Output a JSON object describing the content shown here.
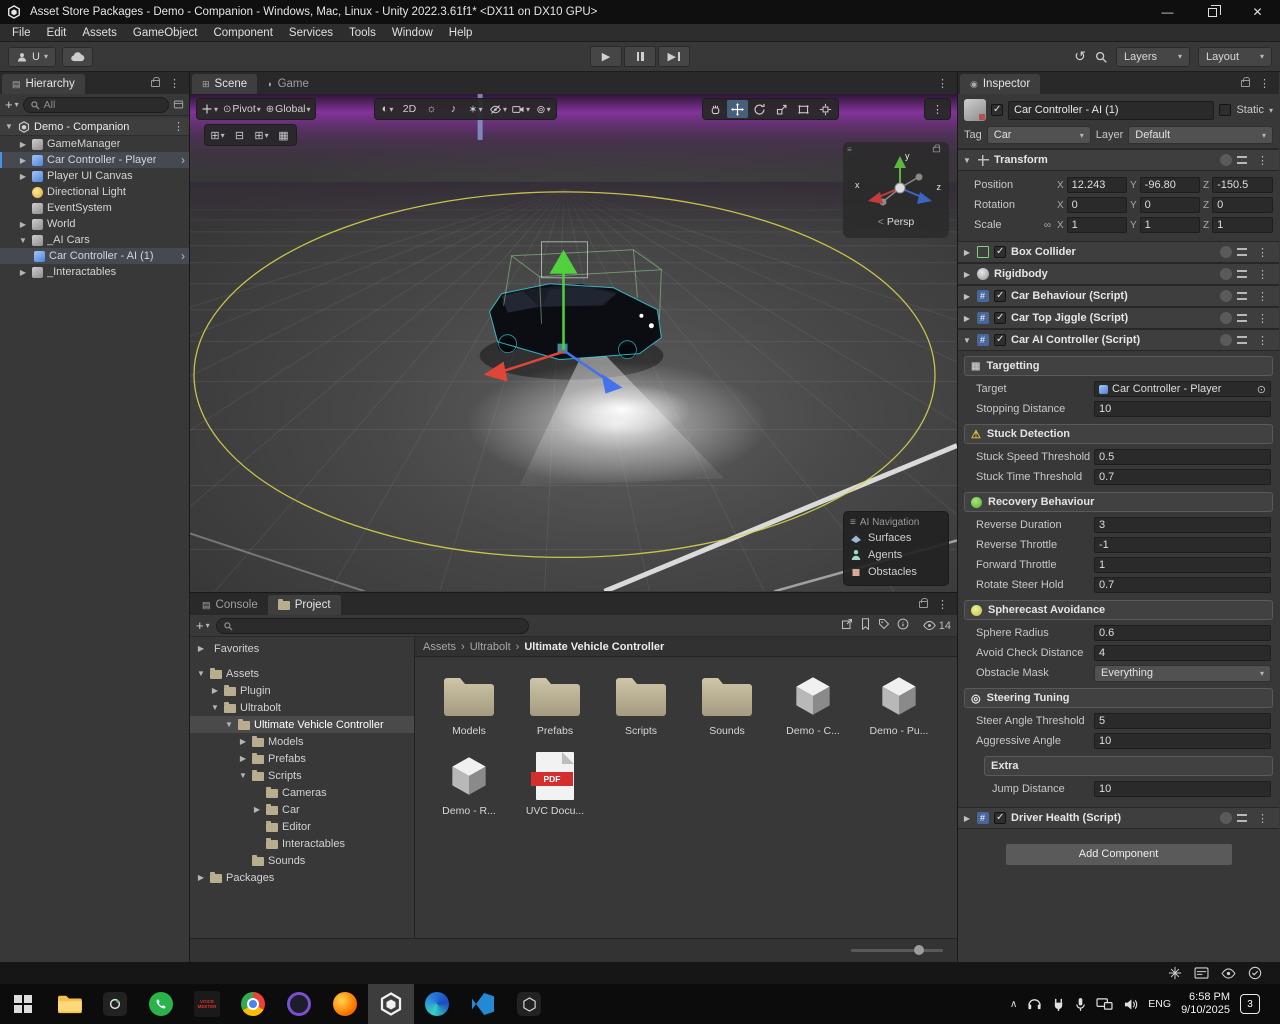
{
  "window": {
    "title": "Asset Store Packages - Demo - Companion - Windows, Mac, Linux - Unity 2022.3.61f1* <DX11 on DX10 GPU>"
  },
  "menu": {
    "items": [
      "File",
      "Edit",
      "Assets",
      "GameObject",
      "Component",
      "Services",
      "Tools",
      "Window",
      "Help"
    ]
  },
  "toolbar": {
    "account": "U",
    "layers": "Layers",
    "layout": "Layout"
  },
  "glyphs": {
    "caret": "▾",
    "open": "▼",
    "closed": "▶",
    "kebab": "⋮",
    "plus": "+",
    "chevron": "›",
    "close": "✕",
    "minimize": "—",
    "play": "▶",
    "undo": "↺",
    "link": "∞",
    "picker": "⊙",
    "list": "▤",
    "grid": "⊞",
    "grid_minus": "⊟",
    "grid_fill": "▦",
    "halfcircle": "◗",
    "insp": "◉",
    "shading": "◐",
    "light": "☼",
    "audio": "♪",
    "fx": "✶",
    "globe": "⊕",
    "gizmos": "⊚",
    "handle": "≡",
    "lt": "<",
    "sep": "›",
    "chevron_up": "∧",
    "hash": "#"
  },
  "hierarchy": {
    "tab": "Hierarchy",
    "filter": "All",
    "scene_name": "Demo - Companion",
    "items": [
      {
        "label": "GameManager",
        "arrow": "▶"
      },
      {
        "label": "Car Controller - Player",
        "arrow": "▶"
      },
      {
        "label": "Player UI Canvas",
        "arrow": "▶"
      },
      {
        "label": "Directional Light",
        "arrow": ""
      },
      {
        "label": "EventSystem",
        "arrow": ""
      },
      {
        "label": "World",
        "arrow": "▶"
      },
      {
        "label": "_AI Cars",
        "arrow": "▼"
      },
      {
        "label": "Car Controller - AI (1)",
        "arrow": ""
      },
      {
        "label": "_Interactables",
        "arrow": "▶"
      }
    ]
  },
  "scene": {
    "tabs": [
      "Scene",
      "Game"
    ],
    "pivot": "Pivot",
    "global": "Global",
    "two_d": "2D",
    "persp": "Persp",
    "axes": {
      "x": "x",
      "y": "y",
      "z": "z"
    },
    "ai_nav": {
      "title": "AI Navigation",
      "rows": [
        "Surfaces",
        "Agents",
        "Obstacles"
      ]
    }
  },
  "project": {
    "tabs": [
      "Console",
      "Project"
    ],
    "favorites": "Favorites",
    "hidden_count": "14",
    "pdf_label": "PDF",
    "tree": [
      {
        "label": "Assets",
        "arrow": "▼"
      },
      {
        "label": "Plugin",
        "arrow": "▶"
      },
      {
        "label": "Ultrabolt",
        "arrow": "▼"
      },
      {
        "label": "Ultimate Vehicle Controller",
        "arrow": "▼"
      },
      {
        "label": "Models",
        "arrow": "▶"
      },
      {
        "label": "Prefabs",
        "arrow": "▶"
      },
      {
        "label": "Scripts",
        "arrow": "▼"
      },
      {
        "label": "Cameras",
        "arrow": ""
      },
      {
        "label": "Car",
        "arrow": "▶"
      },
      {
        "label": "Editor",
        "arrow": ""
      },
      {
        "label": "Interactables",
        "arrow": ""
      },
      {
        "label": "Sounds",
        "arrow": ""
      },
      {
        "label": "Packages",
        "arrow": "▶"
      }
    ],
    "breadcrumb": [
      "Assets",
      "Ultrabolt",
      "Ultimate Vehicle Controller"
    ],
    "items": [
      {
        "label": "Models",
        "type": "folder"
      },
      {
        "label": "Prefabs",
        "type": "folder"
      },
      {
        "label": "Scripts",
        "type": "folder"
      },
      {
        "label": "Sounds",
        "type": "folder"
      },
      {
        "label": "Demo - C...",
        "type": "unity"
      },
      {
        "label": "Demo - Pu...",
        "type": "unity"
      },
      {
        "label": "Demo - R...",
        "type": "unity"
      },
      {
        "label": "UVC Docu...",
        "type": "pdf"
      }
    ]
  },
  "inspector": {
    "tab": "Inspector",
    "header": {
      "name": "Car Controller - AI (1)",
      "static": "Static",
      "tag_label": "Tag",
      "tag": "Car",
      "layer_label": "Layer",
      "layer": "Default"
    },
    "transform": {
      "title": "Transform",
      "axes": {
        "x": "X",
        "y": "Y",
        "z": "Z"
      },
      "rows": [
        {
          "label": "Position",
          "x": "12.243",
          "y": "-96.80",
          "z": "-150.5"
        },
        {
          "label": "Rotation",
          "x": "0",
          "y": "0",
          "z": "0"
        },
        {
          "label": "Scale",
          "x": "1",
          "y": "1",
          "z": "1"
        }
      ]
    },
    "components": [
      {
        "title": "Box Collider"
      },
      {
        "title": "Rigidbody"
      },
      {
        "title": "Car Behaviour (Script)"
      },
      {
        "title": "Car Top Jiggle (Script)"
      },
      {
        "title": "Car AI Controller (Script)"
      },
      {
        "title": "Driver Health (Script)"
      }
    ],
    "car_ai": {
      "sections": [
        {
          "title": "Targetting"
        },
        {
          "title": "Stuck Detection"
        },
        {
          "title": "Recovery Behaviour"
        },
        {
          "title": "Spherecast Avoidance"
        },
        {
          "title": "Steering Tuning"
        },
        {
          "title": "Extra"
        }
      ],
      "target_label": "Target",
      "target_value": "Car Controller - Player",
      "props": [
        {
          "label": "Stopping Distance",
          "value": "10"
        },
        {
          "label": "Stuck Speed Threshold",
          "value": "0.5"
        },
        {
          "label": "Stuck Time Threshold",
          "value": "0.7"
        },
        {
          "label": "Reverse Duration",
          "value": "3"
        },
        {
          "label": "Reverse Throttle",
          "value": "-1"
        },
        {
          "label": "Forward Throttle",
          "value": "1"
        },
        {
          "label": "Rotate Steer Hold",
          "value": "0.7"
        },
        {
          "label": "Sphere Radius",
          "value": "0.6"
        },
        {
          "label": "Avoid Check Distance",
          "value": "4"
        },
        {
          "label": "Obstacle Mask",
          "value": "Everything"
        },
        {
          "label": "Steer Angle Threshold",
          "value": "5"
        },
        {
          "label": "Aggressive Angle",
          "value": "10"
        },
        {
          "label": "Jump Distance",
          "value": "10"
        }
      ]
    },
    "add_component": "Add Component"
  },
  "taskbar": {
    "language": "ENG",
    "time": "6:58 PM",
    "date": "9/10/2025",
    "badge": "3",
    "voicemeeter": "VOICE MEETER"
  }
}
